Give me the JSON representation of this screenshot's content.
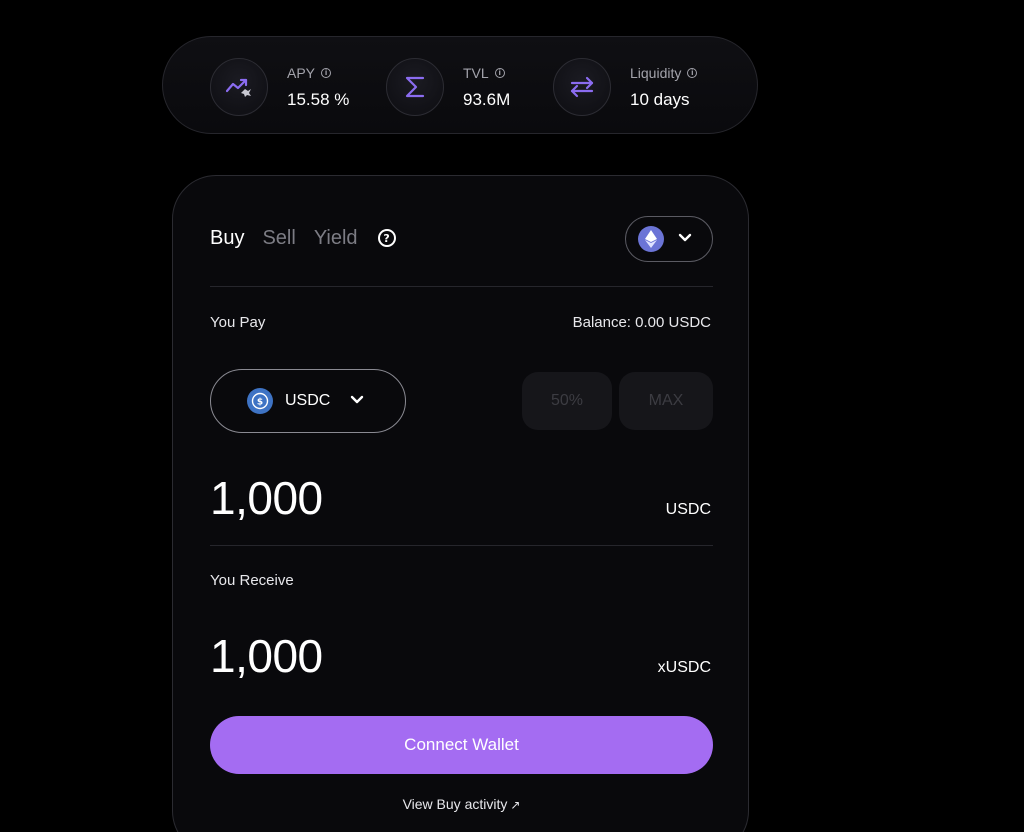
{
  "stats": [
    {
      "label": "APY",
      "value": "15.58 %",
      "icon": "trend-up-icon"
    },
    {
      "label": "TVL",
      "value": "93.6M",
      "icon": "sigma-icon"
    },
    {
      "label": "Liquidity",
      "value": "10 days",
      "icon": "swap-arrows-icon"
    }
  ],
  "tabs": [
    "Buy",
    "Sell",
    "Yield"
  ],
  "active_tab": "Buy",
  "chain_select": {
    "icon": "ethereum-icon"
  },
  "pay": {
    "label": "You Pay",
    "balance": "Balance: 0.00 USDC",
    "token": "USDC",
    "buttons": {
      "half": "50%",
      "max": "MAX"
    },
    "amount": "1,000",
    "unit": "USDC"
  },
  "receive": {
    "label": "You Receive",
    "amount": "1,000",
    "unit": "xUSDC"
  },
  "connect_label": "Connect Wallet",
  "activity_link": "View Buy activity",
  "colors": {
    "accent": "#a46cf2",
    "icon_purple": "#8b6cf0",
    "eth": "#6b74d6",
    "usdc": "#3e73c4"
  }
}
